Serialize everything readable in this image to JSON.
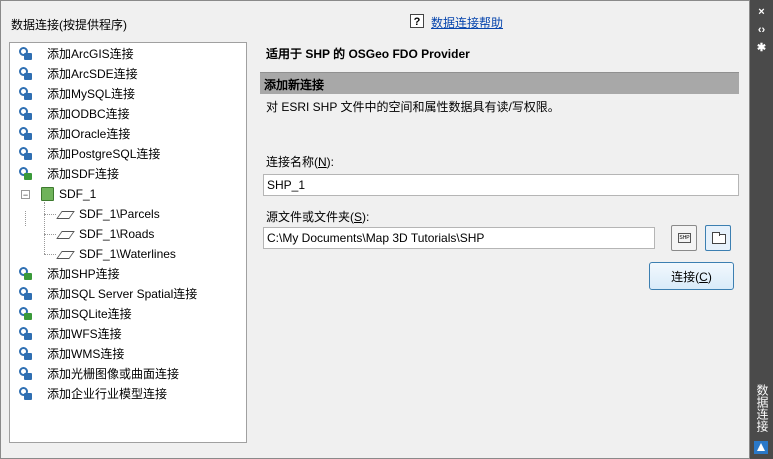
{
  "panel_title": "数据连接(按提供程序)",
  "tree": {
    "items": [
      {
        "label": "添加ArcGIS连接",
        "icon": "connection-icon"
      },
      {
        "label": "添加ArcSDE连接",
        "icon": "connection-icon"
      },
      {
        "label": "添加MySQL连接",
        "icon": "connection-icon"
      },
      {
        "label": "添加ODBC连接",
        "icon": "connection-icon"
      },
      {
        "label": "添加Oracle连接",
        "icon": "connection-icon"
      },
      {
        "label": "添加PostgreSQL连接",
        "icon": "connection-icon"
      },
      {
        "label": "添加SDF连接",
        "icon": "connection-icon"
      },
      {
        "label": "SDF_1",
        "icon": "data-store-icon",
        "expanded": true
      },
      {
        "label": "SDF_1\\Parcels",
        "icon": "feature-class-icon"
      },
      {
        "label": "SDF_1\\Roads",
        "icon": "feature-class-icon"
      },
      {
        "label": "SDF_1\\Waterlines",
        "icon": "feature-class-icon"
      },
      {
        "label": "添加SHP连接",
        "icon": "connection-icon",
        "selected": true
      },
      {
        "label": "添加SQL Server Spatial连接",
        "icon": "connection-icon"
      },
      {
        "label": "添加SQLite连接",
        "icon": "connection-icon"
      },
      {
        "label": "添加WFS连接",
        "icon": "connection-icon"
      },
      {
        "label": "添加WMS连接",
        "icon": "connection-icon"
      },
      {
        "label": "添加光栅图像或曲面连接",
        "icon": "connection-icon"
      },
      {
        "label": "添加企业行业模型连接",
        "icon": "connection-icon"
      }
    ]
  },
  "help_link": "数据连接帮助",
  "provider_heading": "适用于 SHP 的 OSGeo FDO Provider",
  "section_title": "添加新连接",
  "description": "对 ESRI SHP 文件中的空间和属性数据具有读/写权限。",
  "connection_name": {
    "label_pre": "连接名称(",
    "mnemonic": "N",
    "label_post": "):",
    "value": "SHP_1"
  },
  "source": {
    "label_pre": "源文件或文件夹(",
    "mnemonic": "S",
    "label_post": "):",
    "value": "C:\\My Documents\\Map 3D Tutorials\\SHP",
    "shp_icon_text": "SHP"
  },
  "connect_button": {
    "label_pre": "连接(",
    "mnemonic": "C",
    "label_post": ")"
  },
  "side_rail": {
    "label": "数据连接",
    "buttons": [
      "×",
      "‹›",
      "✱"
    ]
  },
  "colors": {
    "section_bar": "#a8a8a8",
    "link": "#0645ad",
    "rail": "#4a4a4a",
    "accent": "#3c7fb1"
  }
}
